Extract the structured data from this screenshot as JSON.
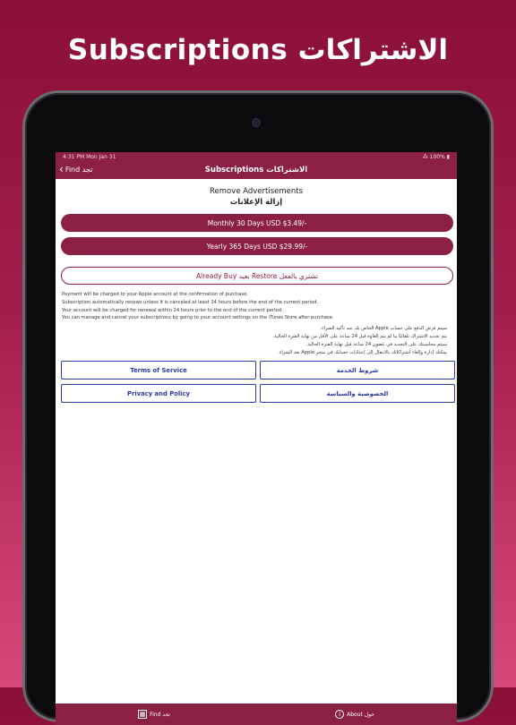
{
  "headline": "Subscriptions الاشتراكات",
  "status": {
    "time_date": "4:31 PM   Mon Jan 31",
    "battery": "⁂ 100% ▮"
  },
  "nav": {
    "back_label": "Find تجد",
    "title": "Subscriptions الاشتراكات"
  },
  "remove": {
    "title_en": "Remove Advertisements",
    "title_ar": "إزالة الإعلانات"
  },
  "plans": {
    "monthly": "Monthly 30 Days USD $3.49/-",
    "yearly": "Yearly 365 Days USD $29.99/-",
    "restore": "Already Buy  بعيد Restore تشتري بالفعل"
  },
  "terms_en": [
    "Payment will be charged to your Apple account at the confirmation of purchase.",
    "Subscription automatically renews unless it is canceled at least 24 hours before the end of the current period.",
    "Your account will be charged for renewal within 24 hours prior to the end of the current period.",
    "You can manage and cancel your subscriptions by going to your account settings on the iTunes Store after purchase."
  ],
  "terms_ar": [
    "سيتم فرض الدفع على حساب Apple الخاص بك عند تأكيد الشراء.",
    "يتم تجديد الاشتراك تلقائيًا ما لم يتم إلغاؤه قبل 24 ساعة على الأقل من نهاية الفترة الحالية.",
    "سيتم محاسبتك على التجديد في غضون 24 ساعة قبل نهاية الفترة الحالية.",
    "يمكنك إدارة وإلغاء اشتراكاتك بالانتقال إلى إعدادات حسابك في متجر Apple بعد الشراء."
  ],
  "links": {
    "terms_en": "Terms of Service",
    "terms_ar": "شروط الخدمة",
    "privacy_en": "Privacy and Policy",
    "privacy_ar": "الخصوصية والسياسة"
  },
  "tabs": {
    "find": "Find تجد",
    "about": "About حول"
  },
  "colors": {
    "brand": "#8c1f44",
    "link": "#2b3aa8"
  }
}
